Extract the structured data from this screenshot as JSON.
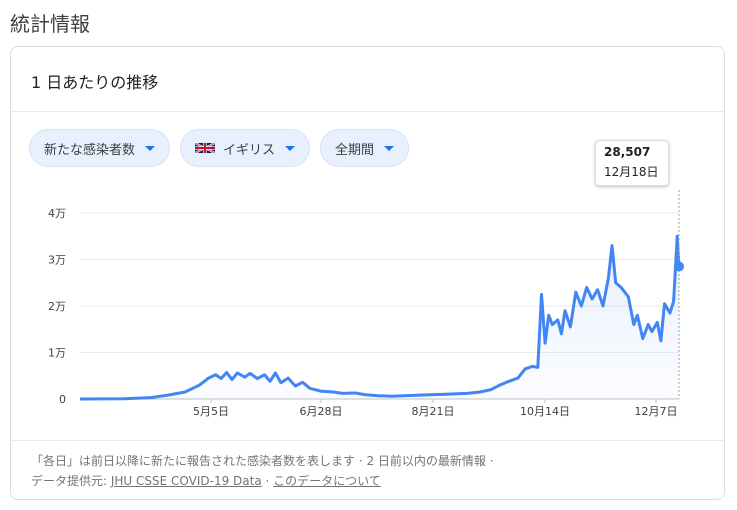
{
  "page": {
    "heading": "統計情報"
  },
  "card": {
    "title": "1 日あたりの推移"
  },
  "filters": [
    {
      "label": "新たな感染者数"
    },
    {
      "label": "イギリス",
      "icon": "uk-flag-icon"
    },
    {
      "label": "全期間"
    }
  ],
  "tooltip": {
    "value": "28,507",
    "date": "12月18日"
  },
  "footer": {
    "line1": "「各日」は前日以降に新たに報告された感染者数を表します · 2 日前以内の最新情報 ·",
    "source_prefix": "データ提供元: ",
    "source_link": "JHU CSSE COVID-19 Data",
    "separator": " · ",
    "about_link": "このデータについて"
  },
  "chart_data": {
    "type": "area",
    "y_ticks": [
      "4万",
      "3万",
      "2万",
      "1万",
      "0"
    ],
    "x_ticks": [
      "5月5日",
      "6月28日",
      "8月21日",
      "10月14日",
      "12月7日"
    ],
    "ylim": [
      0,
      40000
    ],
    "x_range": [
      "2020-01-22",
      "2020-12-18"
    ],
    "line_color": "#4285f4",
    "grid": true,
    "series": [
      {
        "points": [
          [
            "2020-01-22",
            0
          ],
          [
            "2020-02-15",
            50
          ],
          [
            "2020-03-01",
            300
          ],
          [
            "2020-03-10",
            800
          ],
          [
            "2020-03-20",
            1500
          ],
          [
            "2020-03-28",
            3000
          ],
          [
            "2020-04-02",
            4500
          ],
          [
            "2020-04-06",
            5200
          ],
          [
            "2020-04-09",
            4400
          ],
          [
            "2020-04-12",
            5700
          ],
          [
            "2020-04-15",
            4200
          ],
          [
            "2020-04-18",
            5600
          ],
          [
            "2020-04-22",
            4700
          ],
          [
            "2020-04-25",
            5500
          ],
          [
            "2020-04-29",
            4400
          ],
          [
            "2020-05-03",
            5200
          ],
          [
            "2020-05-06",
            3800
          ],
          [
            "2020-05-09",
            5600
          ],
          [
            "2020-05-12",
            3500
          ],
          [
            "2020-05-16",
            4500
          ],
          [
            "2020-05-20",
            2800
          ],
          [
            "2020-05-24",
            3600
          ],
          [
            "2020-05-28",
            2300
          ],
          [
            "2020-06-03",
            1700
          ],
          [
            "2020-06-10",
            1500
          ],
          [
            "2020-06-15",
            1200
          ],
          [
            "2020-06-22",
            1300
          ],
          [
            "2020-06-28",
            900
          ],
          [
            "2020-07-05",
            700
          ],
          [
            "2020-07-12",
            600
          ],
          [
            "2020-07-19",
            700
          ],
          [
            "2020-07-26",
            800
          ],
          [
            "2020-08-02",
            900
          ],
          [
            "2020-08-09",
            1000
          ],
          [
            "2020-08-16",
            1100
          ],
          [
            "2020-08-23",
            1200
          ],
          [
            "2020-08-30",
            1500
          ],
          [
            "2020-09-05",
            2000
          ],
          [
            "2020-09-10",
            3000
          ],
          [
            "2020-09-15",
            3800
          ],
          [
            "2020-09-20",
            4500
          ],
          [
            "2020-09-24",
            6500
          ],
          [
            "2020-09-28",
            7000
          ],
          [
            "2020-10-01",
            6800
          ],
          [
            "2020-10-03",
            22500
          ],
          [
            "2020-10-05",
            12000
          ],
          [
            "2020-10-07",
            18000
          ],
          [
            "2020-10-09",
            16000
          ],
          [
            "2020-10-12",
            17000
          ],
          [
            "2020-10-14",
            14000
          ],
          [
            "2020-10-16",
            19000
          ],
          [
            "2020-10-19",
            15500
          ],
          [
            "2020-10-22",
            23000
          ],
          [
            "2020-10-25",
            20000
          ],
          [
            "2020-10-28",
            24000
          ],
          [
            "2020-10-31",
            21500
          ],
          [
            "2020-11-03",
            23500
          ],
          [
            "2020-11-06",
            20000
          ],
          [
            "2020-11-09",
            26000
          ],
          [
            "2020-11-11",
            33000
          ],
          [
            "2020-11-13",
            25000
          ],
          [
            "2020-11-16",
            24000
          ],
          [
            "2020-11-20",
            22000
          ],
          [
            "2020-11-23",
            16000
          ],
          [
            "2020-11-25",
            18000
          ],
          [
            "2020-11-28",
            13000
          ],
          [
            "2020-12-01",
            16000
          ],
          [
            "2020-12-03",
            14500
          ],
          [
            "2020-12-06",
            16500
          ],
          [
            "2020-12-08",
            12500
          ],
          [
            "2020-12-10",
            20500
          ],
          [
            "2020-12-13",
            18500
          ],
          [
            "2020-12-15",
            21000
          ],
          [
            "2020-12-17",
            35000
          ],
          [
            "2020-12-18",
            28507
          ]
        ]
      }
    ]
  }
}
